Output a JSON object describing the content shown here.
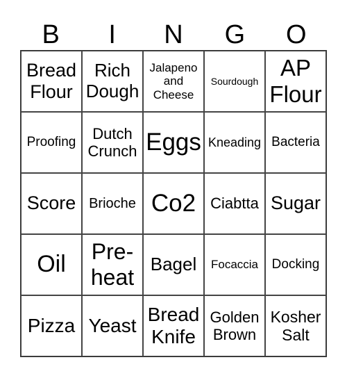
{
  "header": [
    "B",
    "I",
    "N",
    "G",
    "O"
  ],
  "cells": [
    "Bread\nFlour",
    "Rich\nDough",
    "Jalapeno\nand\nCheese",
    "Sourdough",
    "AP\nFlour",
    "Proofing",
    "Dutch\nCrunch",
    "Eggs",
    "Kneading",
    "Bacteria",
    "Score",
    "Brioche",
    "Co2",
    "Ciabtta",
    "Sugar",
    "Oil",
    "Pre-\nheat",
    "Bagel",
    "Focaccia",
    "Docking",
    "Pizza",
    "Yeast",
    "Bread\nKnife",
    "Golden\nBrown",
    "Kosher\nSalt"
  ]
}
